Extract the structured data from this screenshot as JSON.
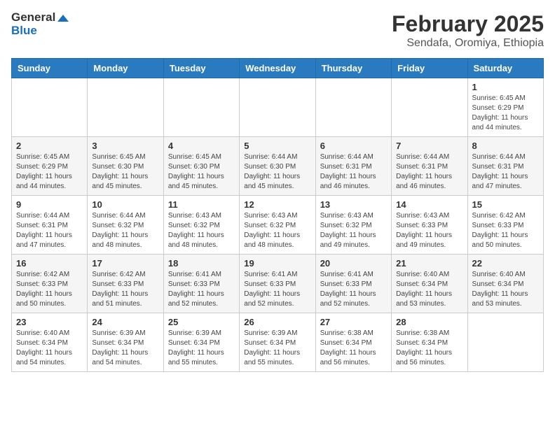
{
  "header": {
    "logo_line1": "General",
    "logo_line2": "Blue",
    "month_title": "February 2025",
    "location": "Sendafa, Oromiya, Ethiopia"
  },
  "days_of_week": [
    "Sunday",
    "Monday",
    "Tuesday",
    "Wednesday",
    "Thursday",
    "Friday",
    "Saturday"
  ],
  "weeks": [
    [
      {
        "day": "",
        "sunrise": "",
        "sunset": "",
        "daylight": ""
      },
      {
        "day": "",
        "sunrise": "",
        "sunset": "",
        "daylight": ""
      },
      {
        "day": "",
        "sunrise": "",
        "sunset": "",
        "daylight": ""
      },
      {
        "day": "",
        "sunrise": "",
        "sunset": "",
        "daylight": ""
      },
      {
        "day": "",
        "sunrise": "",
        "sunset": "",
        "daylight": ""
      },
      {
        "day": "",
        "sunrise": "",
        "sunset": "",
        "daylight": ""
      },
      {
        "day": "1",
        "sunrise": "Sunrise: 6:45 AM",
        "sunset": "Sunset: 6:29 PM",
        "daylight": "Daylight: 11 hours and 44 minutes."
      }
    ],
    [
      {
        "day": "2",
        "sunrise": "Sunrise: 6:45 AM",
        "sunset": "Sunset: 6:29 PM",
        "daylight": "Daylight: 11 hours and 44 minutes."
      },
      {
        "day": "3",
        "sunrise": "Sunrise: 6:45 AM",
        "sunset": "Sunset: 6:30 PM",
        "daylight": "Daylight: 11 hours and 45 minutes."
      },
      {
        "day": "4",
        "sunrise": "Sunrise: 6:45 AM",
        "sunset": "Sunset: 6:30 PM",
        "daylight": "Daylight: 11 hours and 45 minutes."
      },
      {
        "day": "5",
        "sunrise": "Sunrise: 6:44 AM",
        "sunset": "Sunset: 6:30 PM",
        "daylight": "Daylight: 11 hours and 45 minutes."
      },
      {
        "day": "6",
        "sunrise": "Sunrise: 6:44 AM",
        "sunset": "Sunset: 6:31 PM",
        "daylight": "Daylight: 11 hours and 46 minutes."
      },
      {
        "day": "7",
        "sunrise": "Sunrise: 6:44 AM",
        "sunset": "Sunset: 6:31 PM",
        "daylight": "Daylight: 11 hours and 46 minutes."
      },
      {
        "day": "8",
        "sunrise": "Sunrise: 6:44 AM",
        "sunset": "Sunset: 6:31 PM",
        "daylight": "Daylight: 11 hours and 47 minutes."
      }
    ],
    [
      {
        "day": "9",
        "sunrise": "Sunrise: 6:44 AM",
        "sunset": "Sunset: 6:31 PM",
        "daylight": "Daylight: 11 hours and 47 minutes."
      },
      {
        "day": "10",
        "sunrise": "Sunrise: 6:44 AM",
        "sunset": "Sunset: 6:32 PM",
        "daylight": "Daylight: 11 hours and 48 minutes."
      },
      {
        "day": "11",
        "sunrise": "Sunrise: 6:43 AM",
        "sunset": "Sunset: 6:32 PM",
        "daylight": "Daylight: 11 hours and 48 minutes."
      },
      {
        "day": "12",
        "sunrise": "Sunrise: 6:43 AM",
        "sunset": "Sunset: 6:32 PM",
        "daylight": "Daylight: 11 hours and 48 minutes."
      },
      {
        "day": "13",
        "sunrise": "Sunrise: 6:43 AM",
        "sunset": "Sunset: 6:32 PM",
        "daylight": "Daylight: 11 hours and 49 minutes."
      },
      {
        "day": "14",
        "sunrise": "Sunrise: 6:43 AM",
        "sunset": "Sunset: 6:33 PM",
        "daylight": "Daylight: 11 hours and 49 minutes."
      },
      {
        "day": "15",
        "sunrise": "Sunrise: 6:42 AM",
        "sunset": "Sunset: 6:33 PM",
        "daylight": "Daylight: 11 hours and 50 minutes."
      }
    ],
    [
      {
        "day": "16",
        "sunrise": "Sunrise: 6:42 AM",
        "sunset": "Sunset: 6:33 PM",
        "daylight": "Daylight: 11 hours and 50 minutes."
      },
      {
        "day": "17",
        "sunrise": "Sunrise: 6:42 AM",
        "sunset": "Sunset: 6:33 PM",
        "daylight": "Daylight: 11 hours and 51 minutes."
      },
      {
        "day": "18",
        "sunrise": "Sunrise: 6:41 AM",
        "sunset": "Sunset: 6:33 PM",
        "daylight": "Daylight: 11 hours and 52 minutes."
      },
      {
        "day": "19",
        "sunrise": "Sunrise: 6:41 AM",
        "sunset": "Sunset: 6:33 PM",
        "daylight": "Daylight: 11 hours and 52 minutes."
      },
      {
        "day": "20",
        "sunrise": "Sunrise: 6:41 AM",
        "sunset": "Sunset: 6:33 PM",
        "daylight": "Daylight: 11 hours and 52 minutes."
      },
      {
        "day": "21",
        "sunrise": "Sunrise: 6:40 AM",
        "sunset": "Sunset: 6:34 PM",
        "daylight": "Daylight: 11 hours and 53 minutes."
      },
      {
        "day": "22",
        "sunrise": "Sunrise: 6:40 AM",
        "sunset": "Sunset: 6:34 PM",
        "daylight": "Daylight: 11 hours and 53 minutes."
      }
    ],
    [
      {
        "day": "23",
        "sunrise": "Sunrise: 6:40 AM",
        "sunset": "Sunset: 6:34 PM",
        "daylight": "Daylight: 11 hours and 54 minutes."
      },
      {
        "day": "24",
        "sunrise": "Sunrise: 6:39 AM",
        "sunset": "Sunset: 6:34 PM",
        "daylight": "Daylight: 11 hours and 54 minutes."
      },
      {
        "day": "25",
        "sunrise": "Sunrise: 6:39 AM",
        "sunset": "Sunset: 6:34 PM",
        "daylight": "Daylight: 11 hours and 55 minutes."
      },
      {
        "day": "26",
        "sunrise": "Sunrise: 6:39 AM",
        "sunset": "Sunset: 6:34 PM",
        "daylight": "Daylight: 11 hours and 55 minutes."
      },
      {
        "day": "27",
        "sunrise": "Sunrise: 6:38 AM",
        "sunset": "Sunset: 6:34 PM",
        "daylight": "Daylight: 11 hours and 56 minutes."
      },
      {
        "day": "28",
        "sunrise": "Sunrise: 6:38 AM",
        "sunset": "Sunset: 6:34 PM",
        "daylight": "Daylight: 11 hours and 56 minutes."
      },
      {
        "day": "",
        "sunrise": "",
        "sunset": "",
        "daylight": ""
      }
    ]
  ]
}
